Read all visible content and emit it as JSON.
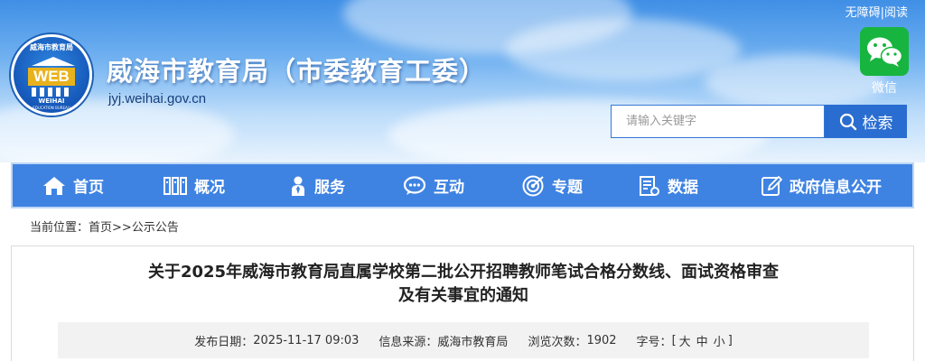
{
  "header": {
    "site_title": "威海市教育局（市委教育工委）",
    "site_url": "jyj.weihai.gov.cn",
    "accessibility": "无障碍|阅读",
    "wechat_label": "微信",
    "logo": {
      "arc_text": "威海市教育局",
      "main": "WEB",
      "sub1": "WEIHAI",
      "sub2": "EDUCATION BUREAU"
    }
  },
  "search": {
    "placeholder": "请输入关键字",
    "button": "检索"
  },
  "nav": {
    "items": [
      {
        "label": "首页",
        "icon": "home-icon"
      },
      {
        "label": "概况",
        "icon": "overview-icon"
      },
      {
        "label": "服务",
        "icon": "service-icon"
      },
      {
        "label": "互动",
        "icon": "interact-icon"
      },
      {
        "label": "专题",
        "icon": "topic-icon"
      },
      {
        "label": "数据",
        "icon": "data-icon"
      },
      {
        "label": "政府信息公开",
        "icon": "gov-info-icon"
      }
    ]
  },
  "breadcrumb": {
    "prefix": "当前位置：",
    "home": "首页",
    "separator": ">>",
    "current": "公示公告"
  },
  "article": {
    "title_line1": "关于2025年威海市教育局直属学校第二批公开招聘教师笔试合格分数线、面试资格审查",
    "title_line2": "及有关事宜的通知",
    "publish_label": "发布日期：",
    "publish_date": "2025-11-17 09:03",
    "source_label": "信息来源：",
    "source": "威海市教育局",
    "views_label": "浏览次数：",
    "views": "1902",
    "fontsize_label": "字号：",
    "fontsize_open": "[",
    "fontsize_large": "大",
    "fontsize_medium": "中",
    "fontsize_small": "小",
    "fontsize_close": "]"
  },
  "colors": {
    "nav_bg": "#3f83e2",
    "search_button": "#2a6dd1",
    "wechat_green": "#17b53f",
    "title_text": "#ffffff"
  }
}
